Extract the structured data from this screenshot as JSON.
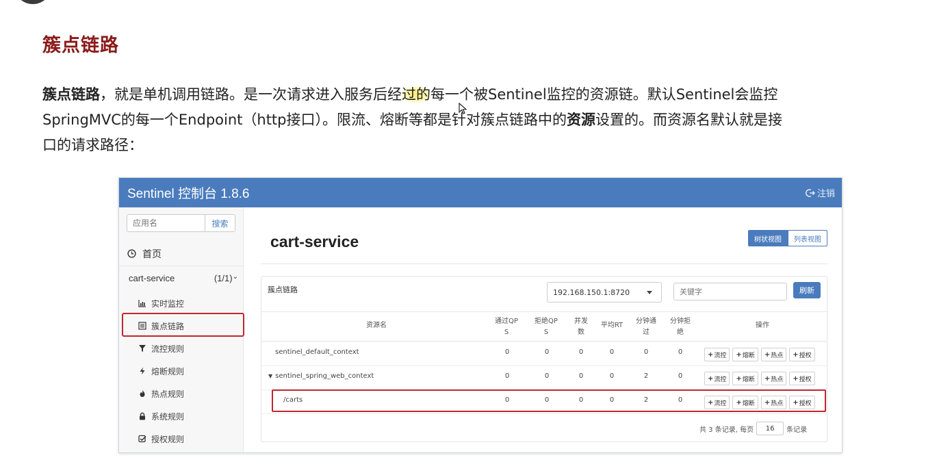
{
  "article": {
    "title": "簇点链路",
    "p1_bold": "簇点链路",
    "p1_a": "，就是单机调用链路。是一次请求进入服务后经",
    "p1_hl": "过的",
    "p1_b": "每一个被Sentinel监控的资源链。默认Sentinel会监控",
    "p2_a": "SpringMVC的每一个Endpoint（http接口）。限流、熔断等都是针对簇点链路中的",
    "p2_bold": "资源",
    "p2_b": "设置的。而资源名默认就是接",
    "p3": "口的请求路径："
  },
  "app": {
    "title": "Sentinel 控制台 1.8.6",
    "logout": "注销"
  },
  "sidebar": {
    "search_placeholder": "应用名",
    "search_btn": "搜索",
    "home": "首页",
    "service_name": "cart-service",
    "service_count": "(1/1)",
    "items": [
      {
        "label": "实时监控",
        "icon": "bar-chart-icon"
      },
      {
        "label": "簇点链路",
        "icon": "list-icon"
      },
      {
        "label": "流控规则",
        "icon": "filter-icon"
      },
      {
        "label": "熔断规则",
        "icon": "bolt-icon"
      },
      {
        "label": "热点规则",
        "icon": "fire-icon"
      },
      {
        "label": "系统规则",
        "icon": "lock-icon"
      },
      {
        "label": "授权规则",
        "icon": "check-square-icon"
      }
    ]
  },
  "main": {
    "title": "cart-service",
    "tree_view": "树状视图",
    "list_view": "列表视图",
    "panel_label": "簇点链路",
    "ip": "192.168.150.1:8720",
    "keyword_placeholder": "关键字",
    "refresh": "刷新",
    "columns": {
      "name": "资源名",
      "pass_qps_1": "通过QP",
      "pass_qps_2": "S",
      "block_qps_1": "拒绝QP",
      "block_qps_2": "S",
      "concurrency_1": "并发",
      "concurrency_2": "数",
      "avg_rt": "平均RT",
      "min_pass_1": "分钟通",
      "min_pass_2": "过",
      "min_block_1": "分钟拒",
      "min_block_2": "绝",
      "ops": "操作"
    },
    "rows": [
      {
        "name": "sentinel_default_context",
        "pass": "0",
        "block": "0",
        "conc": "0",
        "rt": "0",
        "mpass": "0",
        "mblock": "0"
      },
      {
        "name": "sentinel_spring_web_context",
        "pass": "0",
        "block": "0",
        "conc": "0",
        "rt": "0",
        "mpass": "2",
        "mblock": "0"
      },
      {
        "name": "/carts",
        "pass": "0",
        "block": "0",
        "conc": "0",
        "rt": "0",
        "mpass": "2",
        "mblock": "0"
      }
    ],
    "ops": {
      "flow": "流控",
      "degrade": "熔断",
      "hot": "热点",
      "auth": "授权"
    },
    "pager": {
      "prefix": "共 3 条记录, 每页",
      "page_size": "16",
      "suffix": "条记录"
    }
  },
  "colors": {
    "header": "#4a7bbd",
    "title_red": "#8b1a1a",
    "highlight_border": "#c0262d"
  }
}
